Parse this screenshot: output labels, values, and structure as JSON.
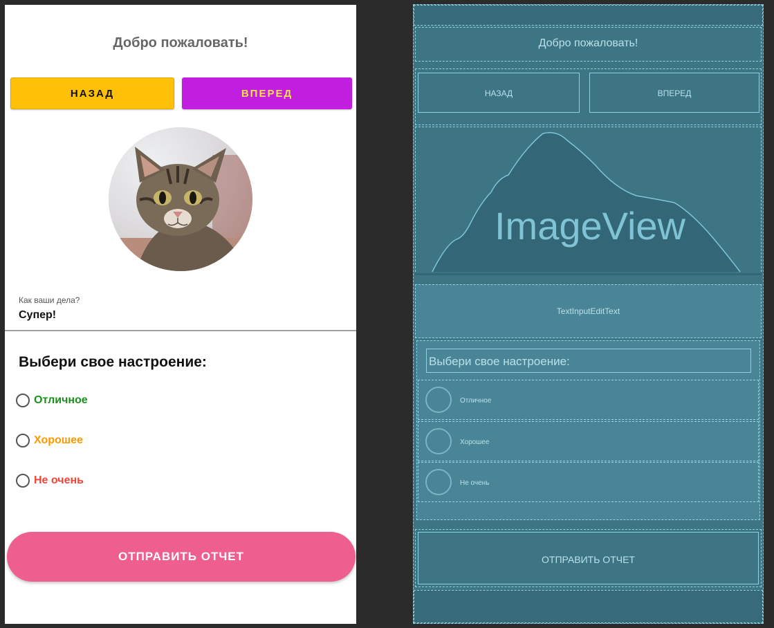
{
  "design": {
    "title": "Добро пожаловать!",
    "back_button": "НАЗАД",
    "forward_button": "ВПЕРЕД",
    "input_hint": "Как ваши дела?",
    "input_value": "Супер!",
    "mood_title": "Выбери свое настроение:",
    "options": [
      {
        "label": "Отличное",
        "color": "#1b8f1b"
      },
      {
        "label": "Хорошее",
        "color": "#ff9800"
      },
      {
        "label": "Не очень",
        "color": "#f44336"
      }
    ],
    "submit_button": "ОТПРАВИТЬ ОТЧЕТ",
    "colors": {
      "back": "#ffc107",
      "forward": "#c21ee0",
      "forward_text": "#f7e24a",
      "submit": "#ee5f8f"
    }
  },
  "blueprint": {
    "title": "Добро пожаловать!",
    "back_button": "НАЗАД",
    "forward_button": "ВПЕРЕД",
    "image_placeholder": "ImageView",
    "edit_text": "TextInputEditText",
    "mood_title": "Выбери свое настроение:",
    "options": [
      "Отличное",
      "Хорошее",
      "Не очень"
    ],
    "submit_button": "ОТПРАВИТЬ ОТЧЕТ",
    "background": "#3e7585"
  }
}
